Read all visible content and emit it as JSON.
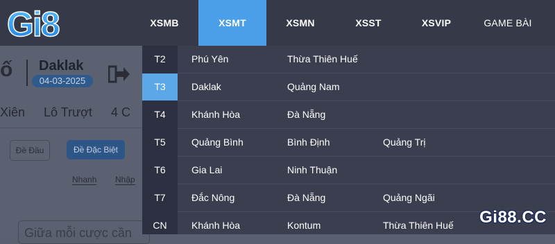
{
  "logo": {
    "text": "Gi8"
  },
  "nav": {
    "items": [
      {
        "label": "XSMB"
      },
      {
        "label": "XSMT"
      },
      {
        "label": "XSMN"
      },
      {
        "label": "XSST"
      },
      {
        "label": "XSVIP"
      },
      {
        "label": "GAME BÀI"
      }
    ],
    "active": "XSMT"
  },
  "background": {
    "title_fragment": "ố",
    "province": "Daklak",
    "date": "04-03-2025",
    "tabs": [
      "Xiên",
      "Lô Trượt",
      "4 C"
    ],
    "button_de_dau": "Đề Đầu",
    "button_de_dac_biet": "Đề Đặc Biệt",
    "radio_nhanh": "Nhanh",
    "radio_nhap": "Nhập",
    "input_placeholder": "Giữa mỗi cược cần"
  },
  "dropdown": {
    "rows": [
      {
        "day": "T2",
        "provinces": [
          "Phú Yên",
          "Thừa Thiên Huế"
        ]
      },
      {
        "day": "T3",
        "provinces": [
          "Daklak",
          "Quảng Nam"
        ],
        "active": true
      },
      {
        "day": "T4",
        "provinces": [
          "Khánh Hòa",
          "Đà Nẵng"
        ]
      },
      {
        "day": "T5",
        "provinces": [
          "Quảng Bình",
          "Bình Định",
          "Quảng Trị"
        ]
      },
      {
        "day": "T6",
        "provinces": [
          "Gia Lai",
          "Ninh Thuận"
        ]
      },
      {
        "day": "T7",
        "provinces": [
          "Đắc Nông",
          "Đà Nẵng",
          "Quảng Ngãi"
        ]
      },
      {
        "day": "CN",
        "provinces": [
          "Khánh Hòa",
          "Kontum",
          "Thừa Thiên Huế"
        ]
      }
    ]
  },
  "watermark": "Gi88.CC",
  "colors": {
    "nav_bg": "#363a48",
    "active_tab": "#4a9fe8",
    "dropdown_bg": "#3b3e4f",
    "day_col_bg": "#2d3040",
    "active_day": "#5ba7e8",
    "logo_blue": "#3aa0f0"
  }
}
